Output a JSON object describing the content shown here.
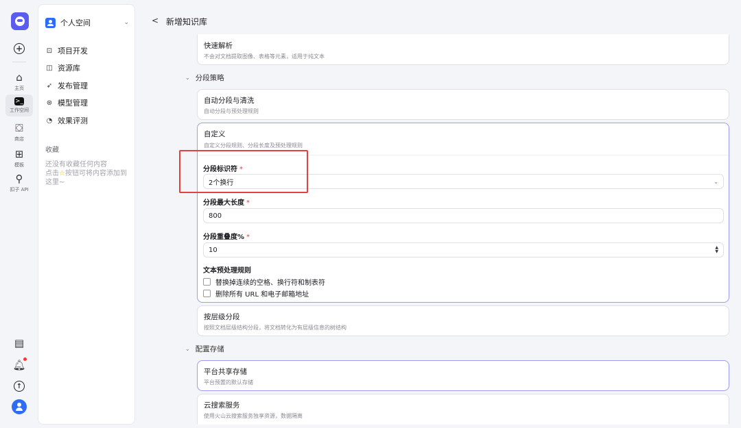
{
  "rail": {
    "items": [
      {
        "icon": "home-icon",
        "label": "主页"
      },
      {
        "icon": "workspace-icon",
        "label": "工作空间"
      },
      {
        "icon": "store-icon",
        "label": "商店"
      },
      {
        "icon": "template-icon",
        "label": "模板"
      },
      {
        "icon": "api-icon",
        "label": "扣子 API"
      }
    ],
    "bottom_icons": [
      "document-icon",
      "bell-icon",
      "upload-icon",
      "avatar"
    ],
    "accent": "#2f6cf6"
  },
  "sidebar": {
    "space_label": "个人空间",
    "items": [
      {
        "icon": "project-icon",
        "label": "项目开发"
      },
      {
        "icon": "library-icon",
        "label": "资源库"
      },
      {
        "icon": "rocket-icon",
        "label": "发布管理"
      },
      {
        "icon": "model-icon",
        "label": "模型管理"
      },
      {
        "icon": "eval-icon",
        "label": "效果评测"
      }
    ],
    "favorites_title": "收藏",
    "favorites_empty_line1": "还没有收藏任何内容",
    "favorites_empty_line2": "点击",
    "favorites_empty_line3": "按钮可将内容添加到",
    "favorites_empty_line4": "这里~"
  },
  "header": {
    "back": "<",
    "title": "新增知识库"
  },
  "parse": {
    "quick_title": "快速解析",
    "quick_desc": "不会对文档提取图像、表格等元素，适用于纯文本"
  },
  "segment": {
    "section_title": "分段策略",
    "auto_title": "自动分段与清洗",
    "auto_desc": "自动分段与预处理规则",
    "custom_title": "自定义",
    "custom_desc": "自定义分段规则、分段长度及预处理规则",
    "identifier_label": "分段标识符",
    "identifier_value": "2个换行",
    "max_len_label": "分段最大长度",
    "max_len_value": "800",
    "overlap_label": "分段重叠度%",
    "overlap_value": "10",
    "preprocess_label": "文本预处理规则",
    "rule1": "替换掉连续的空格、换行符和制表符",
    "rule2": "删除所有 URL 和电子邮箱地址",
    "required_mark": "*",
    "level_title": "按层级分段",
    "level_desc": "按照文档层级结构分段，将文档转化为有层级信息的树结构"
  },
  "storage": {
    "section_title": "配置存储",
    "shared_title": "平台共享存储",
    "shared_desc": "平台预置的默认存储",
    "cloud_title": "云搜索服务",
    "cloud_desc": "使用火山云搜索服务独享资源，数据隔离"
  }
}
